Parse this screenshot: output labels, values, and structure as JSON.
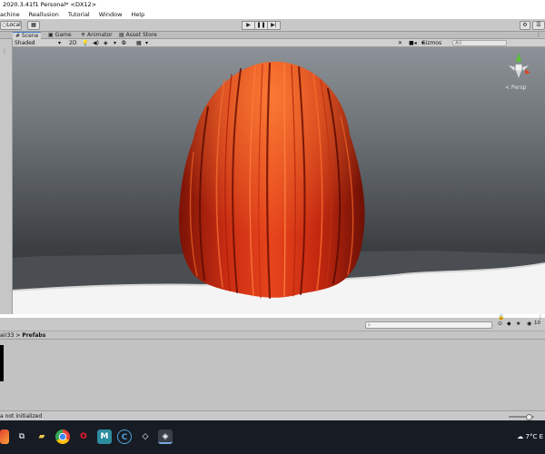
{
  "window": {
    "title": "2020.3.41f1 Personal* <DX12>"
  },
  "menu": {
    "items": [
      "achine",
      "Reallusion",
      "Tutorial",
      "Window",
      "Help"
    ]
  },
  "toolbar": {
    "local_label": "Local",
    "play_icons": [
      "play-icon",
      "pause-icon",
      "step-icon"
    ]
  },
  "tabs": [
    {
      "label": "Scene",
      "icon": "scene-icon"
    },
    {
      "label": "Game",
      "icon": "game-icon"
    },
    {
      "label": "Animator",
      "icon": "animator-icon"
    },
    {
      "label": "Asset Store",
      "icon": "store-icon"
    }
  ],
  "scene_toolbar": {
    "shading_mode": "Shaded",
    "mode_2d": "2D",
    "hidden_count": "0",
    "gizmos_label": "Gizmos",
    "search_placeholder": "All"
  },
  "gizmo": {
    "projection_label": "< Persp"
  },
  "project": {
    "breadcrumb_parent": "air33",
    "breadcrumb_separator": ">",
    "breadcrumb_current": "Prefabs",
    "visibility_count": "10"
  },
  "status": {
    "message": "a not initialized"
  },
  "taskbar": {
    "weather": "7°C",
    "tray_letter": "E",
    "app_icons": [
      "task-view-icon",
      "file-explorer-icon",
      "chrome-icon",
      "opera-icon",
      "mailbird-icon",
      "ccleaner-icon",
      "unity-icon",
      "unity-hub-icon"
    ]
  },
  "colors": {
    "hair": "#d8341a",
    "tab_accent": "#3a79d1",
    "taskbar": "#171c24",
    "ground": "#ffffff"
  }
}
